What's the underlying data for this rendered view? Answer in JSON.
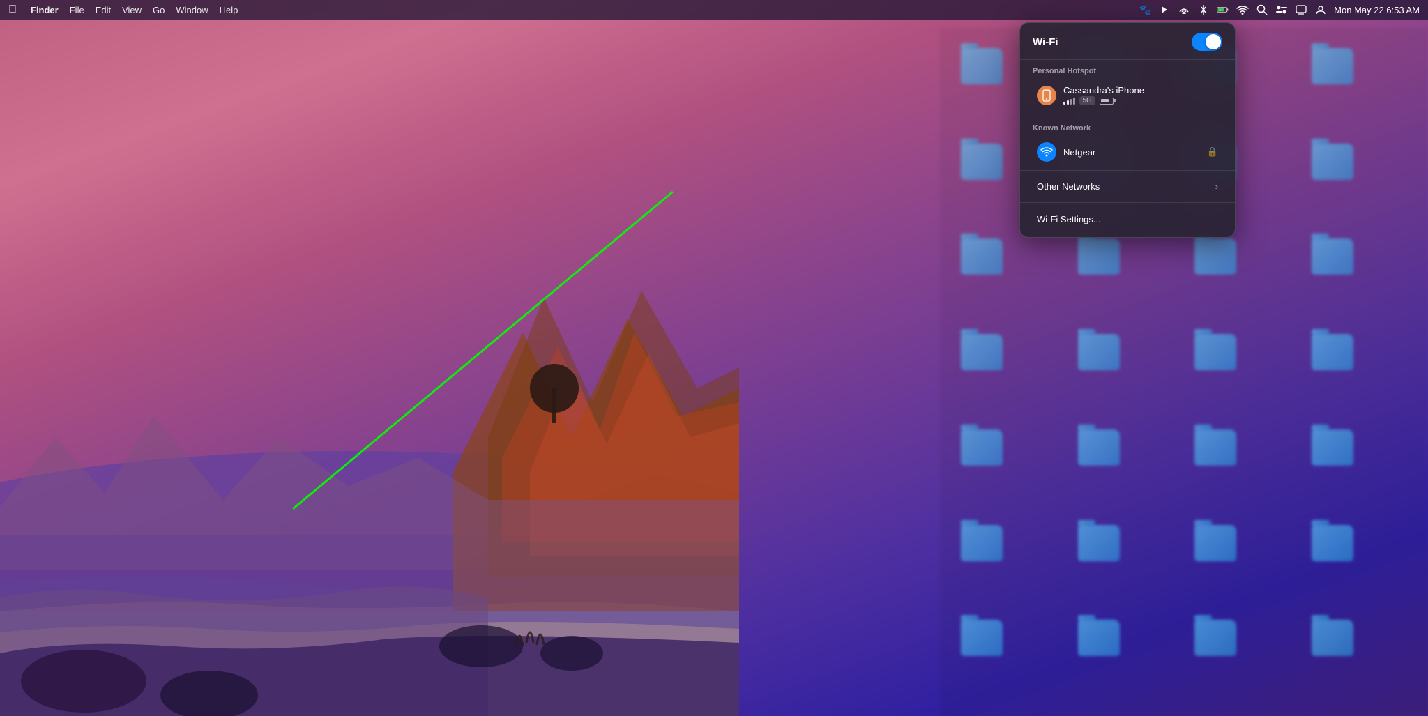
{
  "desktop": {
    "wallpaper_description": "macOS beach sunset landscape"
  },
  "menubar": {
    "apple_label": "",
    "finder_label": "Finder",
    "file_label": "File",
    "edit_label": "Edit",
    "view_label": "View",
    "go_label": "Go",
    "window_label": "Window",
    "help_label": "Help",
    "datetime": "Mon May 22  6:53 AM"
  },
  "wifi_panel": {
    "title": "Wi-Fi",
    "toggle_on": true,
    "personal_hotspot_label": "Personal Hotspot",
    "hotspot_name": "Cassandra's iPhone",
    "hotspot_signal_bars": 2,
    "hotspot_badge": "5G",
    "known_network_label": "Known Network",
    "known_network_name": "Netgear",
    "other_networks_label": "Other Networks",
    "settings_label": "Wi-Fi Settings..."
  }
}
